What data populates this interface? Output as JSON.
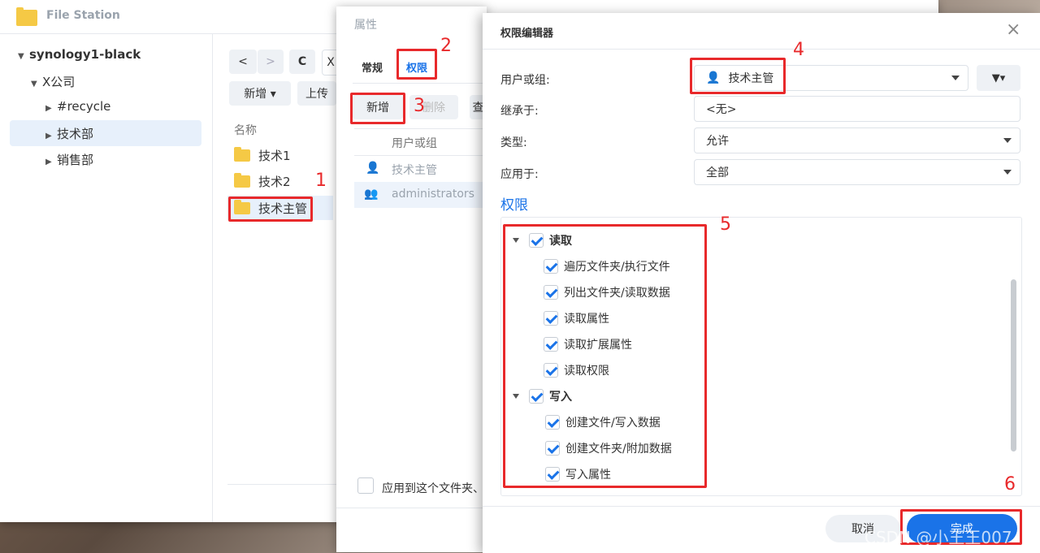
{
  "file_station": {
    "title": "File Station",
    "tree": {
      "root": "synology1-black",
      "company": "X公司",
      "children": [
        "#recycle",
        "技术部",
        "销售部"
      ]
    },
    "toolbar": {
      "back": "<",
      "forward": ">",
      "refresh": "C",
      "path_partial": "X",
      "new": "新增 ▾",
      "upload": "上传"
    },
    "list_header": "名称",
    "folders": [
      "技术1",
      "技术2",
      "技术主管"
    ]
  },
  "properties": {
    "title": "属性",
    "tabs": [
      "常规",
      "权限"
    ],
    "buttons": {
      "add": "新增",
      "delete": "删除",
      "more": "查"
    },
    "columns": {
      "user_or_group": "用户或组"
    },
    "entries": [
      "技术主管",
      "administrators"
    ],
    "apply_checkbox": "应用到这个文件夹、"
  },
  "editor": {
    "title": "权限编辑器",
    "close": "×",
    "fields": {
      "user_or_group": {
        "label": "用户或组:",
        "value": "技术主管"
      },
      "inherit": {
        "label": "继承于:",
        "value": "<无>"
      },
      "type": {
        "label": "类型:",
        "value": "允许"
      },
      "apply_to": {
        "label": "应用于:",
        "value": "全部"
      }
    },
    "section_title": "权限",
    "groups": [
      {
        "name": "读取",
        "items": [
          "遍历文件夹/执行文件",
          "列出文件夹/读取数据",
          "读取属性",
          "读取扩展属性",
          "读取权限"
        ]
      },
      {
        "name": "写入",
        "items": [
          "创建文件/写入数据",
          "创建文件夹/附加数据",
          "写入属性"
        ]
      }
    ],
    "cancel": "取消",
    "done": "完成",
    "filter_icon": "filter-icon"
  },
  "annotations": {
    "n1": "1",
    "n2": "2",
    "n3": "3",
    "n4": "4",
    "n5": "5",
    "n6": "6"
  },
  "watermark": "CSDN @小王王007",
  "colors": {
    "accent": "#1a73e8",
    "annotation": "#e8292b",
    "folder": "#f5c945"
  }
}
